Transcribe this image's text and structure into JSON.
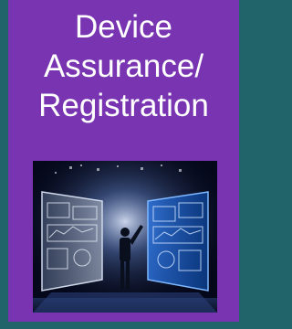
{
  "card": {
    "title_lines": [
      "Device",
      "Assurance/",
      "Registration"
    ]
  },
  "image": {
    "icon": "futuristic-dashboard-image"
  },
  "colors": {
    "background": "#21646a",
    "card": "#7934b1",
    "title_text": "#ffffff"
  }
}
